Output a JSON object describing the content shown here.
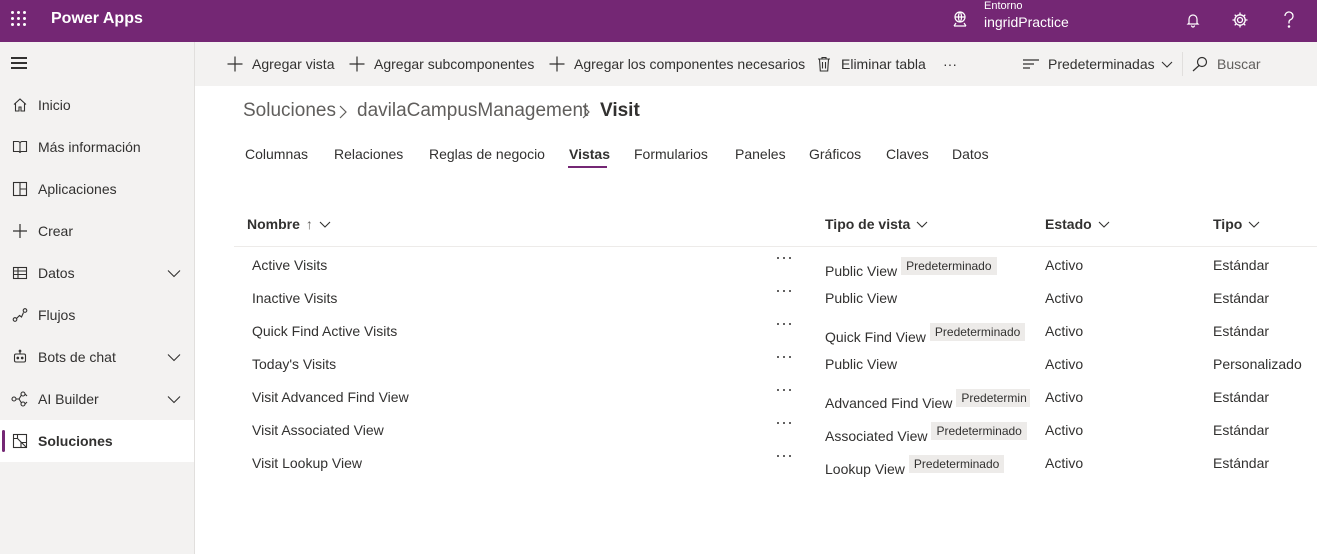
{
  "header": {
    "app_name": "Power Apps",
    "env_label": "Entorno",
    "env_name": "ingridPractice",
    "brand_color": "#742774"
  },
  "nav": {
    "items": [
      {
        "label": "Inicio",
        "icon": "home-icon"
      },
      {
        "label": "Más información",
        "icon": "book-icon"
      },
      {
        "label": "Aplicaciones",
        "icon": "apps-icon"
      },
      {
        "label": "Crear",
        "icon": "plus-icon"
      },
      {
        "label": "Datos",
        "icon": "table-icon"
      },
      {
        "label": "Flujos",
        "icon": "flow-icon"
      },
      {
        "label": "Bots de chat",
        "icon": "bot-icon"
      },
      {
        "label": "AI Builder",
        "icon": "ai-icon"
      },
      {
        "label": "Soluciones",
        "icon": "solutions-icon"
      }
    ]
  },
  "commands": {
    "add_view": "Agregar vista",
    "add_subcomponents": "Agregar subcomponentes",
    "add_required": "Agregar los componentes necesarios",
    "delete_table": "Eliminar tabla",
    "more": "···",
    "default_filter": "Predeterminadas",
    "search": "Buscar"
  },
  "breadcrumb": {
    "root": "Soluciones",
    "solution": "davilaCampusManagement",
    "current": "Visit"
  },
  "tabs": [
    "Columnas",
    "Relaciones",
    "Reglas de negocio",
    "Vistas",
    "Formularios",
    "Paneles",
    "Gráficos",
    "Claves",
    "Datos"
  ],
  "grid": {
    "columns": {
      "name": "Nombre",
      "name_sort": "↑",
      "view_type": "Tipo de vista",
      "status": "Estado",
      "type": "Tipo"
    },
    "rows": [
      {
        "name": "Active Visits",
        "view_type": "Public View",
        "badge": "Predeterminado",
        "status": "Activo",
        "type": "Estándar"
      },
      {
        "name": "Inactive Visits",
        "view_type": "Public View",
        "badge": "",
        "status": "Activo",
        "type": "Estándar"
      },
      {
        "name": "Quick Find Active Visits",
        "view_type": "Quick Find View",
        "badge": "Predeterminado",
        "status": "Activo",
        "type": "Estándar"
      },
      {
        "name": "Today's Visits",
        "view_type": "Public View",
        "badge": "",
        "status": "Activo",
        "type": "Personalizado"
      },
      {
        "name": "Visit Advanced Find View",
        "view_type": "Advanced Find View",
        "badge": "Predetermin",
        "status": "Activo",
        "type": "Estándar"
      },
      {
        "name": "Visit Associated View",
        "view_type": "Associated View",
        "badge": "Predeterminado",
        "status": "Activo",
        "type": "Estándar"
      },
      {
        "name": "Visit Lookup View",
        "view_type": "Lookup View",
        "badge": "Predeterminado",
        "status": "Activo",
        "type": "Estándar"
      }
    ]
  }
}
